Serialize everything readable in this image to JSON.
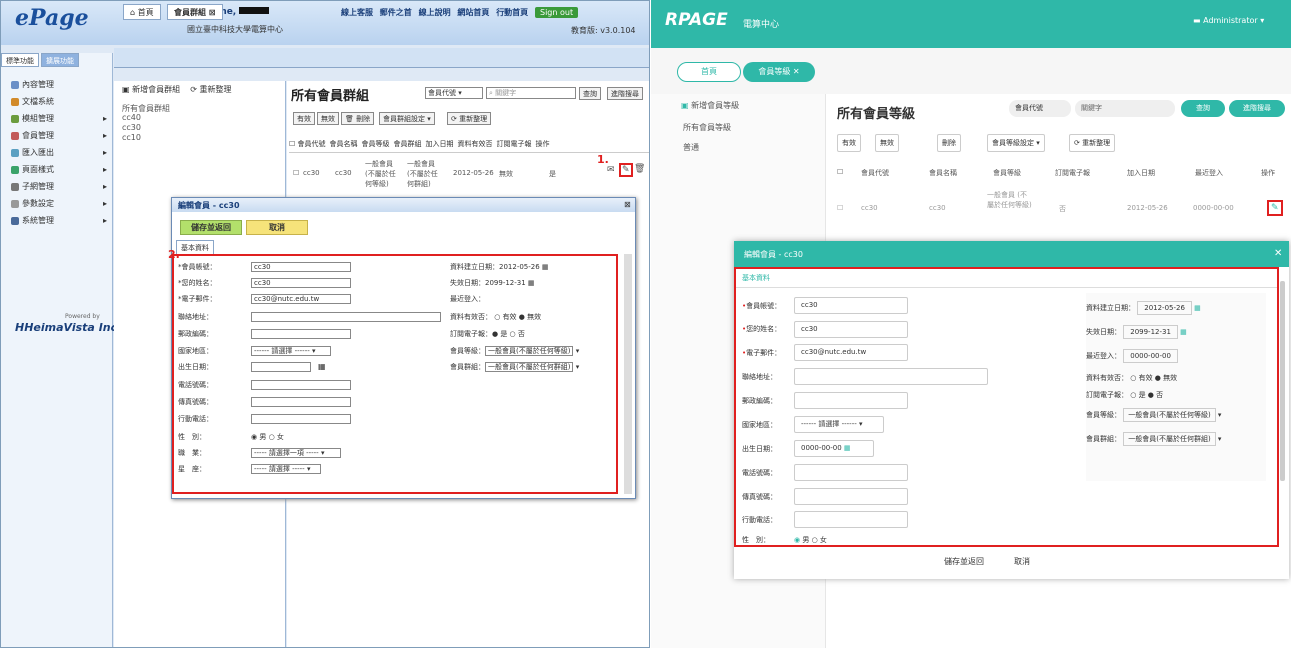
{
  "left": {
    "logo": "ePage",
    "welcome": "Welcome,",
    "school": "國立臺中科技大學電算中心",
    "toplinks": [
      "線上客服",
      "郵件之首",
      "線上說明",
      "網站首頁",
      "行動首頁"
    ],
    "signout": "Sign out",
    "version": "教育版: v3.0.104",
    "sidetabs": [
      "標準功能",
      "擴展功能"
    ],
    "menu": [
      "內容管理",
      "文檔系統",
      "模組管理",
      "會員管理",
      "匯入匯出",
      "頁面樣式",
      "子網管理",
      "參數設定",
      "系統管理"
    ],
    "brand": "HeimaVista Inc.",
    "powered": "Powered by",
    "tabs": [
      "首頁",
      "會員群組"
    ],
    "tree_buttons": [
      "新增會員群組",
      "重新整理"
    ],
    "tree_items": [
      "所有會員群組",
      "cc40",
      "cc30",
      "cc10"
    ],
    "title": "所有會員群組",
    "select": "會員代號",
    "search_placeholder": "關鍵字",
    "btn_query": "查詢",
    "btn_adv": "進階搜尋",
    "actions": [
      "有效",
      "無效",
      "刪除",
      "會員群組設定",
      "重新整理"
    ],
    "columns": [
      "會員代號",
      "會員名稱",
      "會員等級",
      "會員群組",
      "加入日期",
      "資料有效否",
      "訂閱電子報",
      "操作"
    ],
    "row": [
      "cc30",
      "cc30",
      "一般會員 (不屬於任何等級)",
      "一般會員 (不屬於任何群組)",
      "2012-05-26",
      "無效",
      "是"
    ],
    "anno1": "1.",
    "anno2": "2.",
    "modal": {
      "title": "編輯會員 - cc30",
      "save": "儲存並返回",
      "cancel": "取消",
      "tab": "基本資料",
      "labels": [
        "*會員帳號：",
        "*您的姓名：",
        "*電子郵件：",
        "聯絡地址：",
        "郵政編碼：",
        "國家地區：",
        "出生日期：",
        "電話號碼：",
        "傳真號碼：",
        "行動電話：",
        "性　別：",
        "職　業：",
        "星　座："
      ],
      "values": [
        "cc30",
        "cc30",
        "cc30@nutc.edu.tw",
        "",
        "",
        "------ 請選擇 ------",
        "",
        "",
        "",
        "",
        "",
        "----- 請選擇一項 -----",
        "----- 請選擇 -----"
      ],
      "gender": [
        "男",
        "女"
      ],
      "rlabels": [
        "資料建立日期：",
        "失效日期：",
        "最近登入：",
        "資料有效否：",
        "訂閱電子報：",
        "會員等級：",
        "會員群組："
      ],
      "rvalues": [
        "2012-05-26",
        "2099-12-31",
        "",
        "有效 ● 無效",
        "● 是 ○ 否",
        "一般會員(不屬於任何等級)",
        "一般會員(不屬於任何群組)"
      ]
    }
  },
  "right": {
    "logo": "RPAGE",
    "logosub": "電算中心",
    "admin": "Administrator",
    "tabs": [
      "首頁",
      "會員等級"
    ],
    "side": [
      "新增會員等級",
      "所有會員等級",
      "普通"
    ],
    "title": "所有會員等級",
    "select": "會員代號",
    "search": "關鍵字",
    "btn_query": "查詢",
    "btn_adv": "進階搜尋",
    "actions": [
      "有效",
      "無效",
      "刪除",
      "會員等級設定",
      "重新整理"
    ],
    "columns": [
      "會員代號",
      "會員名稱",
      "會員等級",
      "訂閱電子報",
      "加入日期",
      "最近登入",
      "操作"
    ],
    "row": [
      "cc30",
      "cc30",
      "一般會員 (不屬於任何等級)",
      "否",
      "2012-05-26",
      "0000-00-00"
    ],
    "modal": {
      "title": "編輯會員 - cc30",
      "tab": "基本資料",
      "labels": [
        "會員帳號：",
        "您的姓名：",
        "電子郵件：",
        "聯絡地址：",
        "郵政編碼：",
        "國家地區：",
        "出生日期：",
        "電話號碼：",
        "傳真號碼：",
        "行動電話：",
        "性　別："
      ],
      "values": [
        "cc30",
        "cc30",
        "cc30@nutc.edu.tw",
        "",
        "",
        "------ 請選擇 ------",
        "0000-00-00",
        "",
        "",
        "",
        ""
      ],
      "gender": [
        "男",
        "女"
      ],
      "rlabels": [
        "資料建立日期：",
        "失效日期：",
        "最近登入：",
        "資料有效否：",
        "訂閱電子報：",
        "會員等級：",
        "會員群組："
      ],
      "rvalues": [
        "2012-05-26",
        "2099-12-31",
        "0000-00-00",
        "○ 有效 ● 無效",
        "○ 是 ● 否",
        "一般會員(不屬於任何等級)",
        "一般會員(不屬於任何群組)"
      ],
      "save": "儲存並返回",
      "cancel": "取消"
    }
  }
}
